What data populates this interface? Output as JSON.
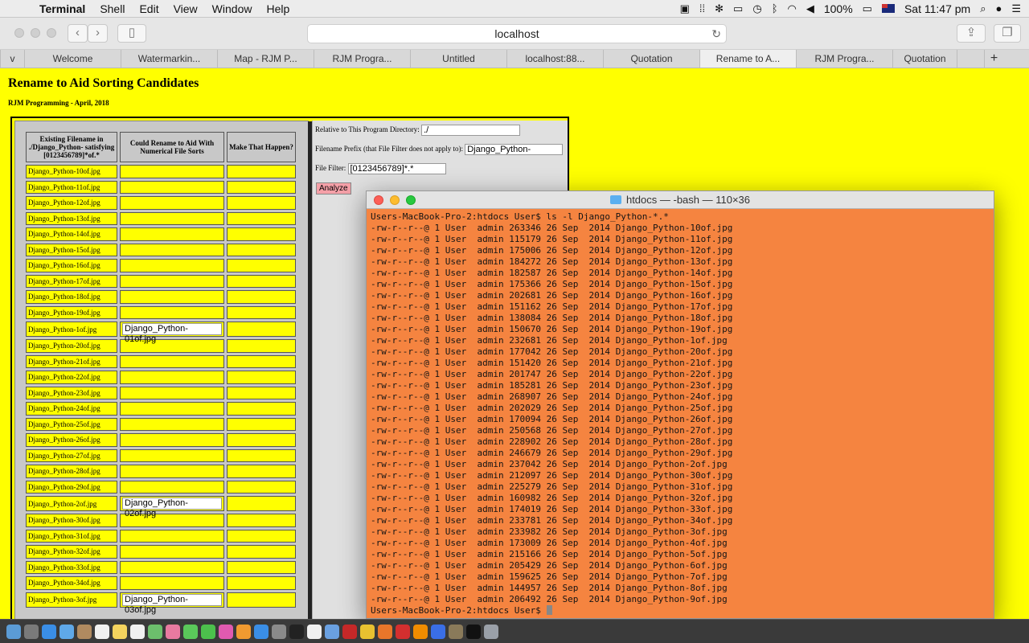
{
  "menubar": {
    "app": "Terminal",
    "items": [
      "Shell",
      "Edit",
      "View",
      "Window",
      "Help"
    ],
    "battery": "100%",
    "clock": "Sat 11:47 pm"
  },
  "browser": {
    "address": "localhost",
    "tabs": [
      "v",
      "Welcome",
      "Watermarkin...",
      "Map - RJM P...",
      "RJM Progra...",
      "Untitled",
      "localhost:88...",
      "Quotation",
      "Rename to A...",
      "RJM Progra...",
      "Quotation"
    ],
    "active_tab": 8
  },
  "page": {
    "title": "Rename to Aid Sorting Candidates",
    "subtitle": "RJM Programming - April, 2018",
    "table": {
      "headers": [
        "Existing Filename in ./Django_Python- satisfying [0123456789]*of.*",
        "Could Rename to Aid With Numerical File Sorts",
        "Make That Happen?"
      ],
      "rows": [
        {
          "name": "Django_Python-10of.jpg",
          "rename": ""
        },
        {
          "name": "Django_Python-11of.jpg",
          "rename": ""
        },
        {
          "name": "Django_Python-12of.jpg",
          "rename": ""
        },
        {
          "name": "Django_Python-13of.jpg",
          "rename": ""
        },
        {
          "name": "Django_Python-14of.jpg",
          "rename": ""
        },
        {
          "name": "Django_Python-15of.jpg",
          "rename": ""
        },
        {
          "name": "Django_Python-16of.jpg",
          "rename": ""
        },
        {
          "name": "Django_Python-17of.jpg",
          "rename": ""
        },
        {
          "name": "Django_Python-18of.jpg",
          "rename": ""
        },
        {
          "name": "Django_Python-19of.jpg",
          "rename": ""
        },
        {
          "name": "Django_Python-1of.jpg",
          "rename": "Django_Python-01of.jpg"
        },
        {
          "name": "Django_Python-20of.jpg",
          "rename": ""
        },
        {
          "name": "Django_Python-21of.jpg",
          "rename": ""
        },
        {
          "name": "Django_Python-22of.jpg",
          "rename": ""
        },
        {
          "name": "Django_Python-23of.jpg",
          "rename": ""
        },
        {
          "name": "Django_Python-24of.jpg",
          "rename": ""
        },
        {
          "name": "Django_Python-25of.jpg",
          "rename": ""
        },
        {
          "name": "Django_Python-26of.jpg",
          "rename": ""
        },
        {
          "name": "Django_Python-27of.jpg",
          "rename": ""
        },
        {
          "name": "Django_Python-28of.jpg",
          "rename": ""
        },
        {
          "name": "Django_Python-29of.jpg",
          "rename": ""
        },
        {
          "name": "Django_Python-2of.jpg",
          "rename": "Django_Python-02of.jpg"
        },
        {
          "name": "Django_Python-30of.jpg",
          "rename": ""
        },
        {
          "name": "Django_Python-31of.jpg",
          "rename": ""
        },
        {
          "name": "Django_Python-32of.jpg",
          "rename": ""
        },
        {
          "name": "Django_Python-33of.jpg",
          "rename": ""
        },
        {
          "name": "Django_Python-34of.jpg",
          "rename": ""
        },
        {
          "name": "Django_Python-3of.jpg",
          "rename": "Django_Python-03of.jpg"
        }
      ]
    },
    "form": {
      "dir_label": "Relative to This Program Directory:",
      "dir_value": "./",
      "prefix_label": "Filename Prefix (that File Filter does not apply to):",
      "prefix_value": "Django_Python-",
      "filter_label": "File Filter:",
      "filter_value": "[0123456789]*.*",
      "analyze": "Analyze"
    }
  },
  "terminal": {
    "title": "htdocs — -bash — 110×36",
    "prompt": "Users-MacBook-Pro-2:htdocs User$ ",
    "command": "ls -l Django_Python-*.*",
    "files": [
      {
        "size": "263346",
        "name": "Django_Python-10of.jpg"
      },
      {
        "size": "115179",
        "name": "Django_Python-11of.jpg"
      },
      {
        "size": "175006",
        "name": "Django_Python-12of.jpg"
      },
      {
        "size": "184272",
        "name": "Django_Python-13of.jpg"
      },
      {
        "size": "182587",
        "name": "Django_Python-14of.jpg"
      },
      {
        "size": "175366",
        "name": "Django_Python-15of.jpg"
      },
      {
        "size": "202681",
        "name": "Django_Python-16of.jpg"
      },
      {
        "size": "151162",
        "name": "Django_Python-17of.jpg"
      },
      {
        "size": "138084",
        "name": "Django_Python-18of.jpg"
      },
      {
        "size": "150670",
        "name": "Django_Python-19of.jpg"
      },
      {
        "size": "232681",
        "name": "Django_Python-1of.jpg"
      },
      {
        "size": "177042",
        "name": "Django_Python-20of.jpg"
      },
      {
        "size": "151420",
        "name": "Django_Python-21of.jpg"
      },
      {
        "size": "201747",
        "name": "Django_Python-22of.jpg"
      },
      {
        "size": "185281",
        "name": "Django_Python-23of.jpg"
      },
      {
        "size": "268907",
        "name": "Django_Python-24of.jpg"
      },
      {
        "size": "202029",
        "name": "Django_Python-25of.jpg"
      },
      {
        "size": "170094",
        "name": "Django_Python-26of.jpg"
      },
      {
        "size": "250568",
        "name": "Django_Python-27of.jpg"
      },
      {
        "size": "228902",
        "name": "Django_Python-28of.jpg"
      },
      {
        "size": "246679",
        "name": "Django_Python-29of.jpg"
      },
      {
        "size": "237042",
        "name": "Django_Python-2of.jpg"
      },
      {
        "size": "212097",
        "name": "Django_Python-30of.jpg"
      },
      {
        "size": "225279",
        "name": "Django_Python-31of.jpg"
      },
      {
        "size": "160982",
        "name": "Django_Python-32of.jpg"
      },
      {
        "size": "174019",
        "name": "Django_Python-33of.jpg"
      },
      {
        "size": "233781",
        "name": "Django_Python-34of.jpg"
      },
      {
        "size": "233982",
        "name": "Django_Python-3of.jpg"
      },
      {
        "size": "173009",
        "name": "Django_Python-4of.jpg"
      },
      {
        "size": "215166",
        "name": "Django_Python-5of.jpg"
      },
      {
        "size": "205429",
        "name": "Django_Python-6of.jpg"
      },
      {
        "size": "159625",
        "name": "Django_Python-7of.jpg"
      },
      {
        "size": "144957",
        "name": "Django_Python-8of.jpg"
      },
      {
        "size": "206492",
        "name": "Django_Python-9of.jpg"
      }
    ],
    "perm": "-rw-r--r--@ 1 User  admin",
    "date": "26 Sep  2014"
  },
  "dock": {
    "icons": [
      "finder-icon",
      "launchpad-icon",
      "safari-icon",
      "mail-icon",
      "contacts-icon",
      "calendar-icon",
      "notes-icon",
      "reminders-icon",
      "maps-icon",
      "photos-icon",
      "messages-icon",
      "facetime-icon",
      "itunes-icon",
      "ibooks-icon",
      "appstore-icon",
      "preferences-icon",
      "terminal-icon",
      "textedit-icon",
      "preview-icon",
      "filezilla-icon",
      "chrome-icon",
      "firefox-icon",
      "opera-icon",
      "vlc-icon",
      "xcode-icon",
      "gimp-icon",
      "iterm-icon",
      "trash-icon"
    ],
    "colors": [
      "#5b9bd5",
      "#7a7a7a",
      "#3a8ee6",
      "#5fa8e8",
      "#b08a60",
      "#f0f0f0",
      "#f4d35e",
      "#f0f0f0",
      "#6cbf6c",
      "#e87aa0",
      "#5ac85a",
      "#4cc04c",
      "#e05ab0",
      "#f09a30",
      "#3a8ee6",
      "#8a8a8a",
      "#222",
      "#f0f0f0",
      "#6aa0e0",
      "#c62828",
      "#e8c130",
      "#e8762a",
      "#d32f2f",
      "#f08c00",
      "#3a6ee6",
      "#8a7a5a",
      "#111",
      "#9aa0a8"
    ]
  }
}
